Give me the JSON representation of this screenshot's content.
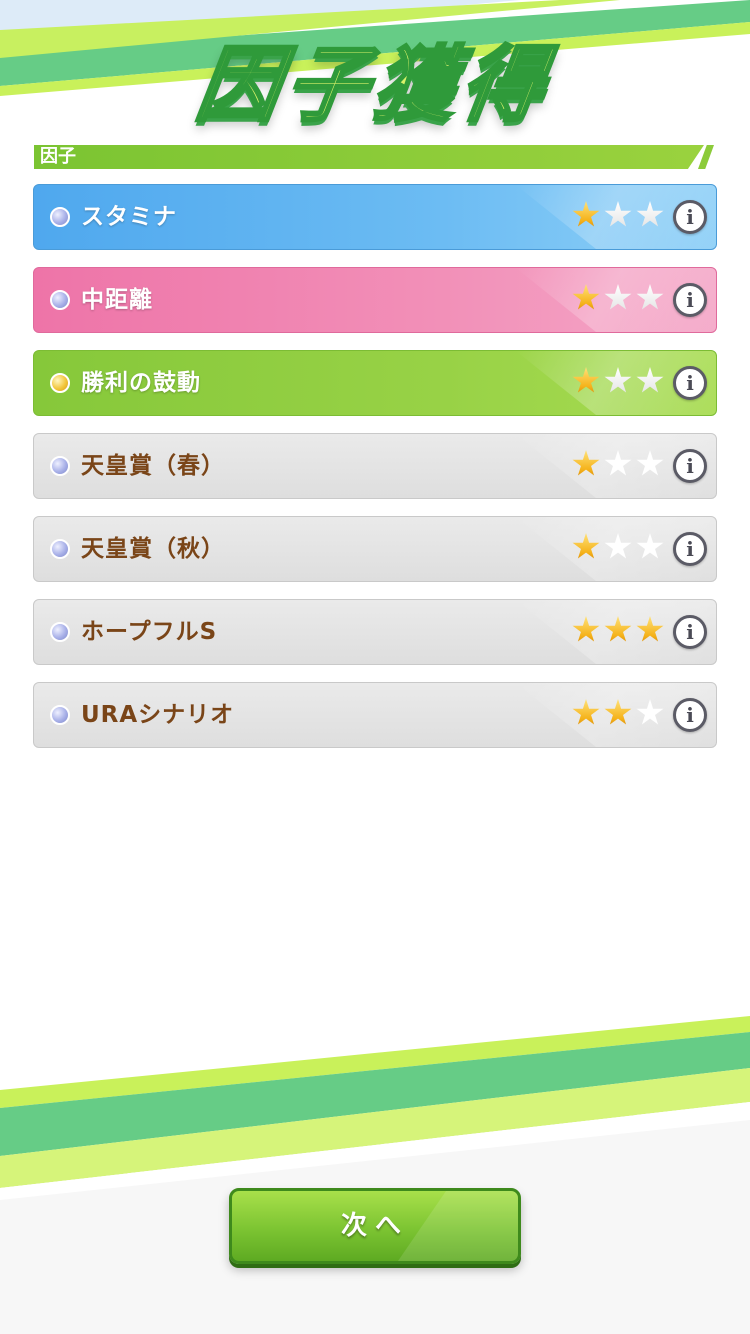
{
  "header": {
    "title": "因子獲得"
  },
  "section": {
    "label": "因子"
  },
  "factors": [
    {
      "name": "スタミナ",
      "stars": 1,
      "max_stars": 3,
      "color": "#5fb3f0",
      "gem": "silver"
    },
    {
      "name": "中距離",
      "stars": 1,
      "max_stars": 3,
      "color": "#f080ae",
      "gem": "silver"
    },
    {
      "name": "勝利の鼓動",
      "stars": 1,
      "max_stars": 3,
      "color": "#92cf42",
      "gem": "gold"
    },
    {
      "name": "天皇賞（春）",
      "stars": 1,
      "max_stars": 3,
      "color": "#e2e2e2",
      "gem": "silver"
    },
    {
      "name": "天皇賞（秋）",
      "stars": 1,
      "max_stars": 3,
      "color": "#e2e2e2",
      "gem": "silver"
    },
    {
      "name": "ホープフルS",
      "stars": 3,
      "max_stars": 3,
      "color": "#e2e2e2",
      "gem": "silver"
    },
    {
      "name": "URAシナリオ",
      "stars": 2,
      "max_stars": 3,
      "color": "#e2e2e2",
      "gem": "silver"
    }
  ],
  "info_icon": {
    "glyph": "i",
    "icon": "info-icon"
  },
  "footer": {
    "next_label": "次へ"
  },
  "colors": {
    "accent_green": "#7cc432",
    "factor_text": "#7a4518",
    "star": "#f5b21a"
  }
}
